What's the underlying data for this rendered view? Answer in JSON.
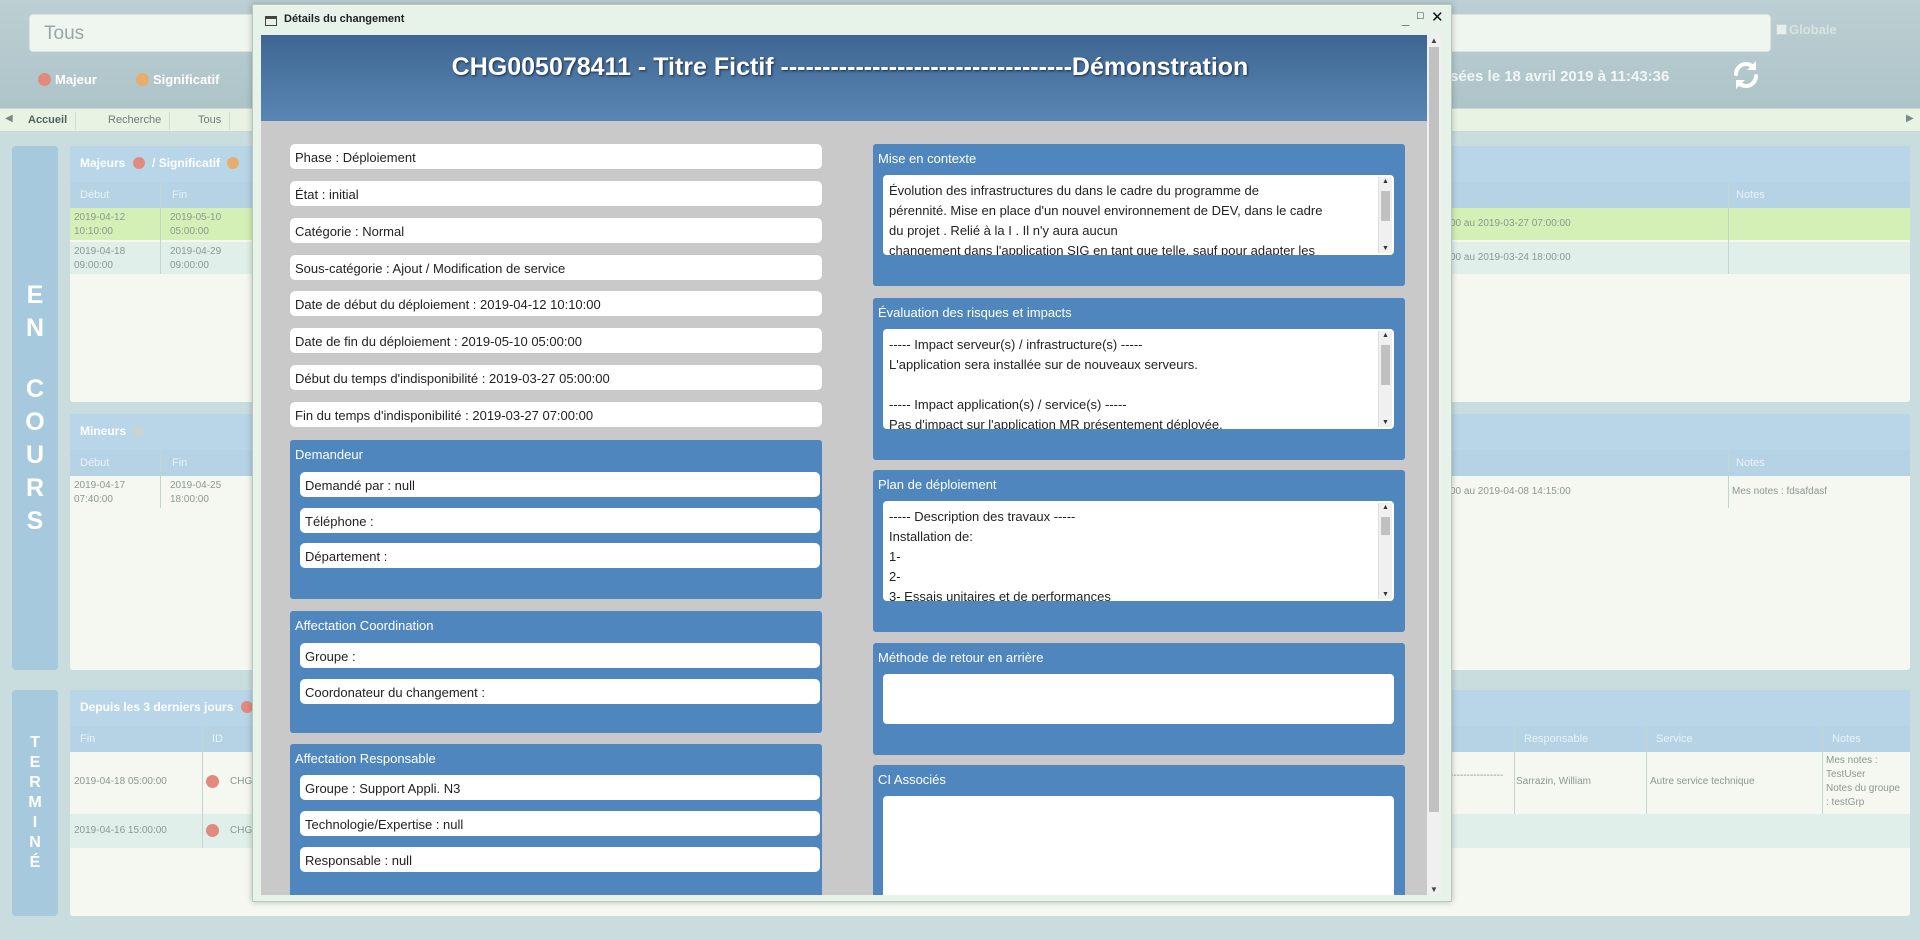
{
  "app": {
    "search": {
      "placeholder": "Tous"
    },
    "globale_label": "Globale",
    "legend": {
      "majeur": "Majeur",
      "significatif": "Significatif"
    },
    "update_text": "sées le 18 avril 2019 à 11:43:36",
    "tabs": [
      "Accueil",
      "Recherche",
      "Tous"
    ],
    "en_cours_label": [
      "E",
      "N",
      "",
      "C",
      "O",
      "U",
      "R",
      "S"
    ],
    "termine_label": [
      "T",
      "E",
      "R",
      "M",
      "I",
      "N",
      "É"
    ],
    "panel_majeurs": {
      "title": "Majeurs",
      "title_sep": "/ Significatif",
      "cols": {
        "debut": "Début",
        "fin": "Fin",
        "notes": "Notes"
      },
      "rows": [
        {
          "debut": [
            "2019-04-12",
            "10:10:00"
          ],
          "fin": [
            "2019-05-10",
            "05:00:00"
          ],
          "range": "00 au 2019-03-27 07:00:00",
          "notes": ""
        },
        {
          "debut": [
            "2019-04-18",
            "09:00:00"
          ],
          "fin": [
            "2019-04-29",
            "09:00:00"
          ],
          "range": "00 au 2019-03-24 18:00:00",
          "notes": ""
        }
      ]
    },
    "panel_mineurs": {
      "title": "Mineurs",
      "cols": {
        "debut": "Début",
        "fin": "Fin",
        "notes": "Notes"
      },
      "rows": [
        {
          "debut": [
            "2019-04-17",
            "07:40:00"
          ],
          "fin": [
            "2019-04-25",
            "18:00:00"
          ],
          "range": "00 au 2019-04-08 14:15:00",
          "notes": "Mes notes : fdsafdasf"
        }
      ]
    },
    "panel_termines": {
      "title": "Depuis les 3 derniers jours",
      "cols": {
        "fin": "Fin",
        "id": "ID",
        "responsable": "Responsable",
        "service": "Service",
        "notes": "Notes"
      },
      "rows": [
        {
          "fin": "2019-04-18 05:00:00",
          "id": "CHG",
          "dashes": "----------------",
          "responsable": "Sarrazin, William",
          "service": "Autre service technique",
          "notes": [
            "Mes notes :",
            "TestUser",
            "Notes du groupe",
            ": testGrp"
          ]
        },
        {
          "fin": "2019-04-16 15:00:00",
          "id": "CHG",
          "dashes": "",
          "responsable": "",
          "service": "",
          "notes": []
        }
      ]
    }
  },
  "modal": {
    "window_title": "Détails du changement",
    "header_title": "CHG005078411 - Titre Fictif -----------------------------------Démonstration",
    "fields": {
      "phase": "Phase : Déploiement",
      "etat": "État : initial",
      "categorie": "Catégorie : Normal",
      "sous_categorie": "Sous-catégorie : Ajout / Modification de service",
      "date_debut": "Date de début du déploiement : 2019-04-12 10:10:00",
      "date_fin": "Date de fin du déploiement : 2019-05-10 05:00:00",
      "debut_indispo": "Début du temps d'indisponibilité : 2019-03-27 05:00:00",
      "fin_indispo": "Fin du temps d'indisponibilité : 2019-03-27 07:00:00"
    },
    "demandeur": {
      "title": "Demandeur",
      "demande_par": "Demandé par : null",
      "telephone": "Téléphone :",
      "departement": "Département :"
    },
    "coordination": {
      "title": "Affectation Coordination",
      "groupe": "Groupe :",
      "coordonateur": "Coordonateur du changement :"
    },
    "responsable": {
      "title": "Affectation Responsable",
      "groupe": "Groupe : Support Appli. N3",
      "technologie": "Technologie/Expertise : null",
      "responsable": "Responsable : null"
    },
    "mise_en_contexte": {
      "title": "Mise en contexte",
      "lines": [
        "Évolution des infrastructures du         dans le cadre du programme de",
        "pérennité. Mise en place d'un nouvel environnement de DEV, dans le cadre",
        "du projet               . Relié à la I                                 . Il n'y aura aucun",
        "changement dans l'application SIG en tant que telle, sauf pour adapter les"
      ]
    },
    "evaluation": {
      "title": "Évaluation des risques et impacts",
      "lines": [
        "----- Impact serveur(s) / infrastructure(s) -----",
        "L'application sera installée sur de nouveaux serveurs.",
        "",
        "----- Impact application(s) / service(s) -----",
        "Pas d'impact sur l'application MR présentement déployée."
      ]
    },
    "plan": {
      "title": "Plan de déploiement",
      "lines": [
        "----- Description des travaux -----",
        "Installation de:",
        "1-",
        "2-",
        "3- Essais unitaires et de performances"
      ]
    },
    "retour": {
      "title": "Méthode de retour en arrière",
      "text": ""
    },
    "ci": {
      "title": "CI Associés",
      "text": ""
    }
  }
}
